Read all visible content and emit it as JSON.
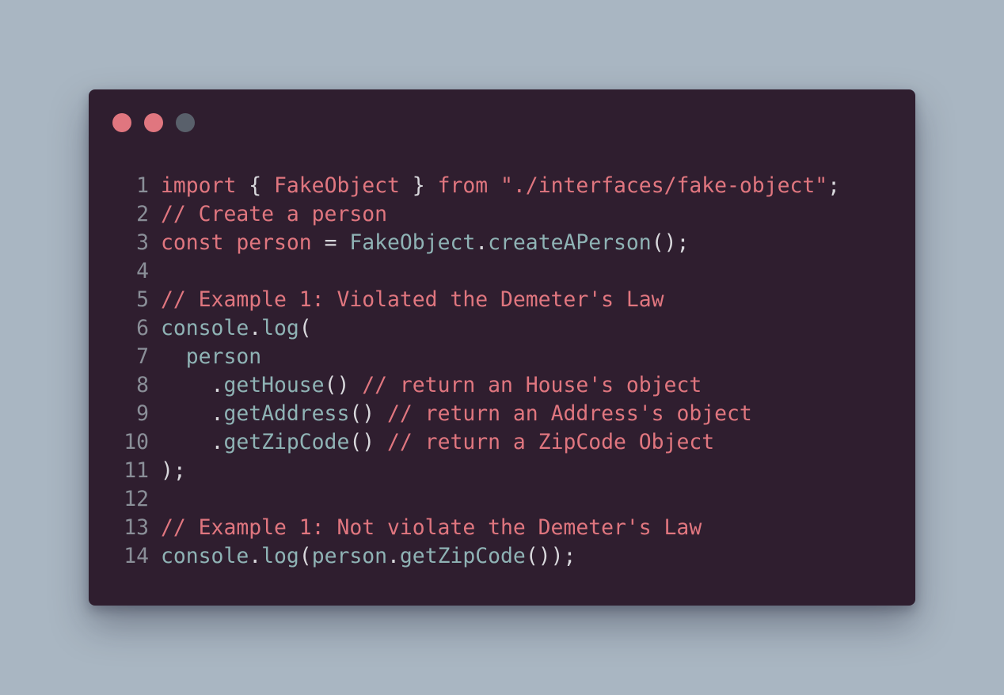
{
  "colors": {
    "background": "#a9b6c2",
    "window": "#2f1e2f",
    "keyword": "#e0767f",
    "identifier": "#8fb3b5",
    "punctuation": "#d8d8dc",
    "line_number": "#8a8f98"
  },
  "window_controls": [
    {
      "name": "close-dot",
      "color": "#e0767f"
    },
    {
      "name": "minimize-dot",
      "color": "#e0767f"
    },
    {
      "name": "maximize-dot",
      "color": "#59606b"
    }
  ],
  "code": {
    "lines": [
      {
        "n": "1",
        "tokens": [
          {
            "t": "import",
            "c": "kw"
          },
          {
            "t": " ",
            "c": "pn"
          },
          {
            "t": "{",
            "c": "pn"
          },
          {
            "t": " ",
            "c": "pn"
          },
          {
            "t": "FakeObject",
            "c": "kw"
          },
          {
            "t": " ",
            "c": "pn"
          },
          {
            "t": "}",
            "c": "pn"
          },
          {
            "t": " ",
            "c": "pn"
          },
          {
            "t": "from",
            "c": "kw"
          },
          {
            "t": " ",
            "c": "pn"
          },
          {
            "t": "\"./interfaces/fake-object\"",
            "c": "str"
          },
          {
            "t": ";",
            "c": "pn"
          }
        ]
      },
      {
        "n": "2",
        "tokens": [
          {
            "t": "// Create a person",
            "c": "cm"
          }
        ]
      },
      {
        "n": "3",
        "tokens": [
          {
            "t": "const",
            "c": "kw"
          },
          {
            "t": " ",
            "c": "pn"
          },
          {
            "t": "person",
            "c": "kw"
          },
          {
            "t": " = ",
            "c": "pn"
          },
          {
            "t": "FakeObject",
            "c": "id"
          },
          {
            "t": ".",
            "c": "pn"
          },
          {
            "t": "createAPerson",
            "c": "id"
          },
          {
            "t": "();",
            "c": "pn"
          }
        ]
      },
      {
        "n": "4",
        "tokens": []
      },
      {
        "n": "5",
        "tokens": [
          {
            "t": "// Example 1: Violated the Demeter's Law",
            "c": "cm"
          }
        ]
      },
      {
        "n": "6",
        "tokens": [
          {
            "t": "console",
            "c": "id"
          },
          {
            "t": ".",
            "c": "pn"
          },
          {
            "t": "log",
            "c": "id"
          },
          {
            "t": "(",
            "c": "pn"
          }
        ]
      },
      {
        "n": "7",
        "tokens": [
          {
            "t": "  ",
            "c": "pn"
          },
          {
            "t": "person",
            "c": "id"
          }
        ]
      },
      {
        "n": "8",
        "tokens": [
          {
            "t": "    .",
            "c": "pn"
          },
          {
            "t": "getHouse",
            "c": "id"
          },
          {
            "t": "() ",
            "c": "pn"
          },
          {
            "t": "// return an House's object",
            "c": "cm"
          }
        ]
      },
      {
        "n": "9",
        "tokens": [
          {
            "t": "    .",
            "c": "pn"
          },
          {
            "t": "getAddress",
            "c": "id"
          },
          {
            "t": "() ",
            "c": "pn"
          },
          {
            "t": "// return an Address's object",
            "c": "cm"
          }
        ]
      },
      {
        "n": "10",
        "tokens": [
          {
            "t": "    .",
            "c": "pn"
          },
          {
            "t": "getZipCode",
            "c": "id"
          },
          {
            "t": "() ",
            "c": "pn"
          },
          {
            "t": "// return a ZipCode Object",
            "c": "cm"
          }
        ]
      },
      {
        "n": "11",
        "tokens": [
          {
            "t": ");",
            "c": "pn"
          }
        ]
      },
      {
        "n": "12",
        "tokens": []
      },
      {
        "n": "13",
        "tokens": [
          {
            "t": "// Example 1: Not violate the Demeter's Law",
            "c": "cm"
          }
        ]
      },
      {
        "n": "14",
        "tokens": [
          {
            "t": "console",
            "c": "id"
          },
          {
            "t": ".",
            "c": "pn"
          },
          {
            "t": "log",
            "c": "id"
          },
          {
            "t": "(",
            "c": "pn"
          },
          {
            "t": "person",
            "c": "id"
          },
          {
            "t": ".",
            "c": "pn"
          },
          {
            "t": "getZipCode",
            "c": "id"
          },
          {
            "t": "());",
            "c": "pn"
          }
        ]
      }
    ]
  }
}
